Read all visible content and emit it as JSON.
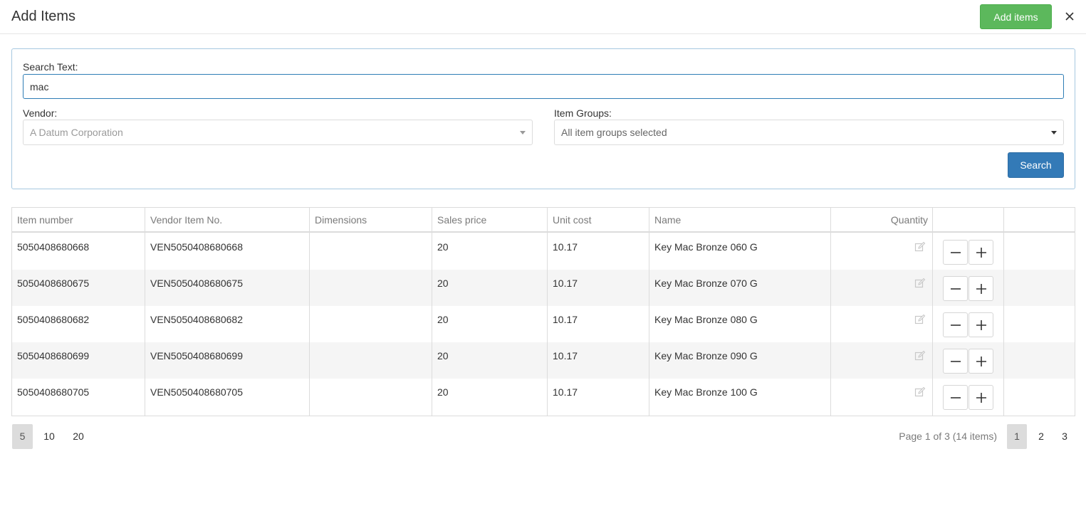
{
  "dialog": {
    "title": "Add Items",
    "add_items_label": "Add items",
    "close_icon": "close-icon"
  },
  "search": {
    "search_text_label": "Search Text:",
    "search_text_value": "mac",
    "vendor_label": "Vendor:",
    "vendor_value": "A Datum Corporation",
    "item_groups_label": "Item Groups:",
    "item_groups_value": "All item groups selected",
    "search_button_label": "Search"
  },
  "table": {
    "headers": [
      "Item number",
      "Vendor Item No.",
      "Dimensions",
      "Sales price",
      "Unit cost",
      "Name",
      "Quantity",
      "",
      ""
    ],
    "rows": [
      {
        "item_number": "5050408680668",
        "vendor_item_no": "VEN5050408680668",
        "dimensions": "",
        "sales_price": "20",
        "unit_cost": "10.17",
        "name": "Key Mac Bronze 060 G"
      },
      {
        "item_number": "5050408680675",
        "vendor_item_no": "VEN5050408680675",
        "dimensions": "",
        "sales_price": "20",
        "unit_cost": "10.17",
        "name": "Key Mac Bronze 070 G"
      },
      {
        "item_number": "5050408680682",
        "vendor_item_no": "VEN5050408680682",
        "dimensions": "",
        "sales_price": "20",
        "unit_cost": "10.17",
        "name": "Key Mac Bronze 080 G"
      },
      {
        "item_number": "5050408680699",
        "vendor_item_no": "VEN5050408680699",
        "dimensions": "",
        "sales_price": "20",
        "unit_cost": "10.17",
        "name": "Key Mac Bronze 090 G"
      },
      {
        "item_number": "5050408680705",
        "vendor_item_no": "VEN5050408680705",
        "dimensions": "",
        "sales_price": "20",
        "unit_cost": "10.17",
        "name": "Key Mac Bronze 100 G"
      }
    ]
  },
  "pager": {
    "page_sizes": [
      "5",
      "10",
      "20"
    ],
    "selected_page_size": "5",
    "info": "Page 1 of 3 (14 items)",
    "pages": [
      "1",
      "2",
      "3"
    ],
    "current_page": "1"
  },
  "colors": {
    "add_button": "#5cb85c",
    "search_button": "#337ab7",
    "panel_border": "#a6c8e0",
    "row_alt": "#f5f5f5"
  }
}
